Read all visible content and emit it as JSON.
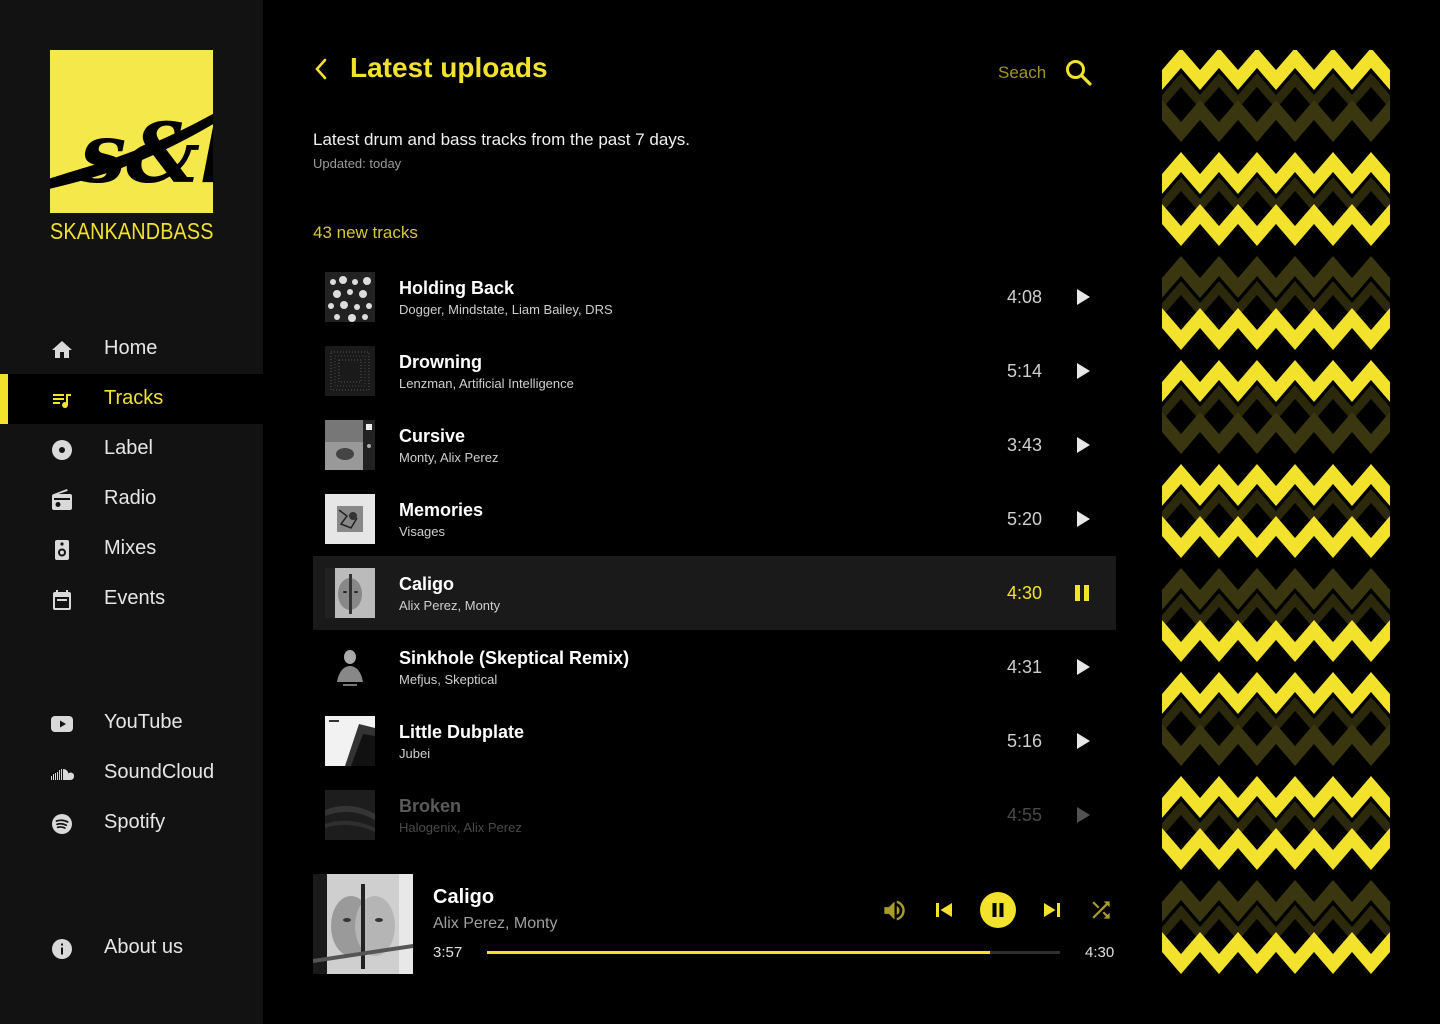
{
  "brand": {
    "name": "SKANKANDBASS",
    "logo_text": "s&b"
  },
  "nav": {
    "main": [
      {
        "label": "Home",
        "icon": "home-icon",
        "active": false
      },
      {
        "label": "Tracks",
        "icon": "playlist-icon",
        "active": true
      },
      {
        "label": "Label",
        "icon": "disc-icon",
        "active": false
      },
      {
        "label": "Radio",
        "icon": "radio-icon",
        "active": false
      },
      {
        "label": "Mixes",
        "icon": "speaker-icon",
        "active": false
      },
      {
        "label": "Events",
        "icon": "calendar-icon",
        "active": false
      }
    ],
    "social": [
      {
        "label": "YouTube",
        "icon": "youtube-icon"
      },
      {
        "label": "SoundCloud",
        "icon": "soundcloud-icon"
      },
      {
        "label": "Spotify",
        "icon": "spotify-icon"
      }
    ],
    "about": {
      "label": "About us",
      "icon": "info-icon"
    }
  },
  "header": {
    "title": "Latest uploads",
    "search_label": "Seach"
  },
  "intro": {
    "description": "Latest drum and bass tracks from the past 7 days.",
    "updated": "Updated: today",
    "track_count": "43 new tracks"
  },
  "tracks": [
    {
      "title": "Holding Back",
      "artists": "Dogger, Mindstate, Liam Bailey, DRS",
      "duration": "4:08",
      "state": "idle"
    },
    {
      "title": "Drowning",
      "artists": "Lenzman, Artificial Intelligence",
      "duration": "5:14",
      "state": "idle"
    },
    {
      "title": "Cursive",
      "artists": "Monty, Alix Perez",
      "duration": "3:43",
      "state": "idle"
    },
    {
      "title": "Memories",
      "artists": "Visages",
      "duration": "5:20",
      "state": "idle"
    },
    {
      "title": "Caligo",
      "artists": "Alix Perez, Monty",
      "duration": "4:30",
      "state": "playing"
    },
    {
      "title": "Sinkhole (Skeptical Remix)",
      "artists": "Mefjus, Skeptical",
      "duration": "4:31",
      "state": "idle"
    },
    {
      "title": "Little Dubplate",
      "artists": "Jubei",
      "duration": "5:16",
      "state": "idle"
    },
    {
      "title": "Broken",
      "artists": "Halogenix, Alix Perez",
      "duration": "4:55",
      "state": "idle"
    }
  ],
  "player": {
    "title": "Caligo",
    "artists": "Alix Perez, Monty",
    "current_time": "3:57",
    "total_time": "4:30",
    "progress": 0.8778
  },
  "colors": {
    "accent": "#f2e22b",
    "background": "#000000",
    "sidebar": "#121212"
  }
}
